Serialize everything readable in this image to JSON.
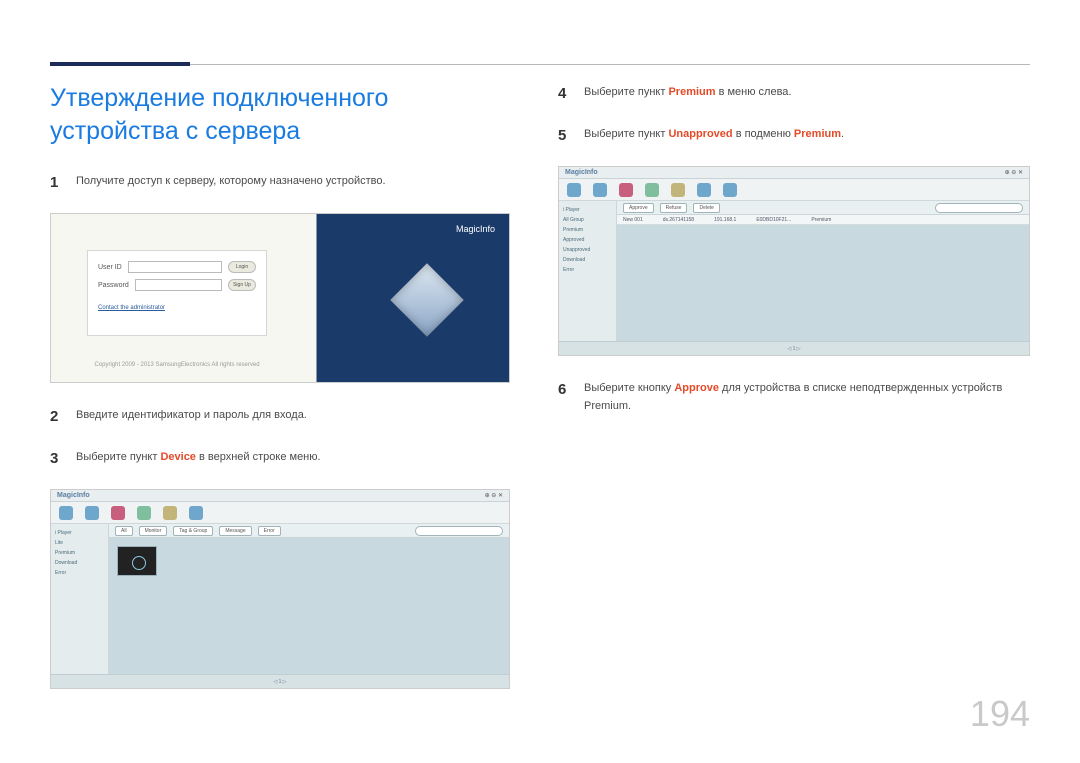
{
  "page_number": "194",
  "section_title": "Утверждение подключенного устройства с сервера",
  "step1": {
    "num": "1",
    "text": "Получите доступ к серверу, которому назначено устройство."
  },
  "step2": {
    "num": "2",
    "text": "Введите идентификатор и пароль для входа."
  },
  "step3": {
    "num": "3",
    "pre": "Выберите пункт ",
    "hl": "Device",
    "post": " в верхней строке меню."
  },
  "step4": {
    "num": "4",
    "pre": "Выберите пункт ",
    "hl": "Premium",
    "post": " в меню слева."
  },
  "step5": {
    "num": "5",
    "pre": "Выберите пункт ",
    "hl1": "Unapproved",
    "mid": " в подменю ",
    "hl2": "Premium",
    "post": "."
  },
  "step6": {
    "num": "6",
    "pre": "Выберите кнопку ",
    "hl": "Approve",
    "post": " для устройства в списке неподтвержденных устройств Premium."
  },
  "login_shot": {
    "brand": "MagicInfo",
    "userid_label": "User ID",
    "password_label": "Password",
    "login_btn": "Login",
    "signup_btn": "Sign Up",
    "contact_link": "Contact the administrator",
    "copyright": "Copyright 2009 - 2013 SamsungElectronics All rights reserved"
  },
  "app_shot1": {
    "logo": "MagicInfo",
    "sidebar_items": [
      "i Player",
      "Lite",
      "Premium",
      "Download",
      "Error"
    ],
    "segments": [
      "All",
      "Monitor",
      "Tag & Group",
      "Message",
      "Error"
    ]
  },
  "app_shot2": {
    "logo": "MagicInfo",
    "sidebar_items": [
      "i Player",
      "All Group",
      "Premium",
      "Approved",
      "Unapproved",
      "Download",
      "Error"
    ],
    "segments": [
      "Approve",
      "Refuse",
      "Delete"
    ],
    "row": {
      "name": "New 001",
      "group": "ds.267141158",
      "ip": "191.168.1",
      "mac": "E0DBD10F21...",
      "model": "Premium"
    }
  }
}
